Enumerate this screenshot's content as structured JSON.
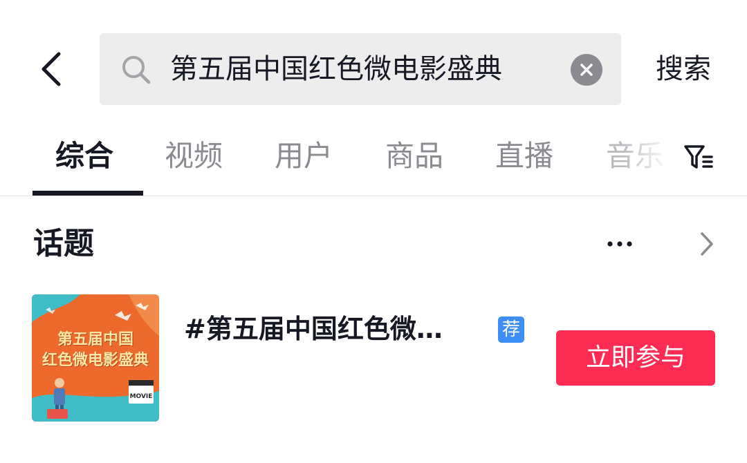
{
  "search": {
    "query": "第五届中国红色微电影盛典",
    "submit_label": "搜索"
  },
  "tabs": [
    {
      "label": "综合",
      "active": true
    },
    {
      "label": "视频",
      "active": false
    },
    {
      "label": "用户",
      "active": false
    },
    {
      "label": "商品",
      "active": false
    },
    {
      "label": "直播",
      "active": false
    },
    {
      "label": "音乐",
      "active": false
    }
  ],
  "section": {
    "title": "话题"
  },
  "topic": {
    "name": "#第五届中国红色微电影盛典",
    "display_name": "#第五届中国红色微…",
    "badge": "荐",
    "join_label": "立即参与",
    "cover": {
      "line1": "第五届中国",
      "line2": "红色微电影盛典",
      "clapper_text": "MOVIE"
    }
  },
  "colors": {
    "accent": "#fe2c55",
    "badge": "#3d8ef5",
    "search_bg": "#ededee",
    "cover_orange": "#ee6a2c",
    "cover_teal": "#3fbcc6"
  },
  "icons": {
    "back": "chevron-left-icon",
    "search": "search-icon",
    "clear": "clear-icon",
    "filter": "filter-icon",
    "more": "more-icon",
    "chevron": "chevron-right-icon"
  }
}
